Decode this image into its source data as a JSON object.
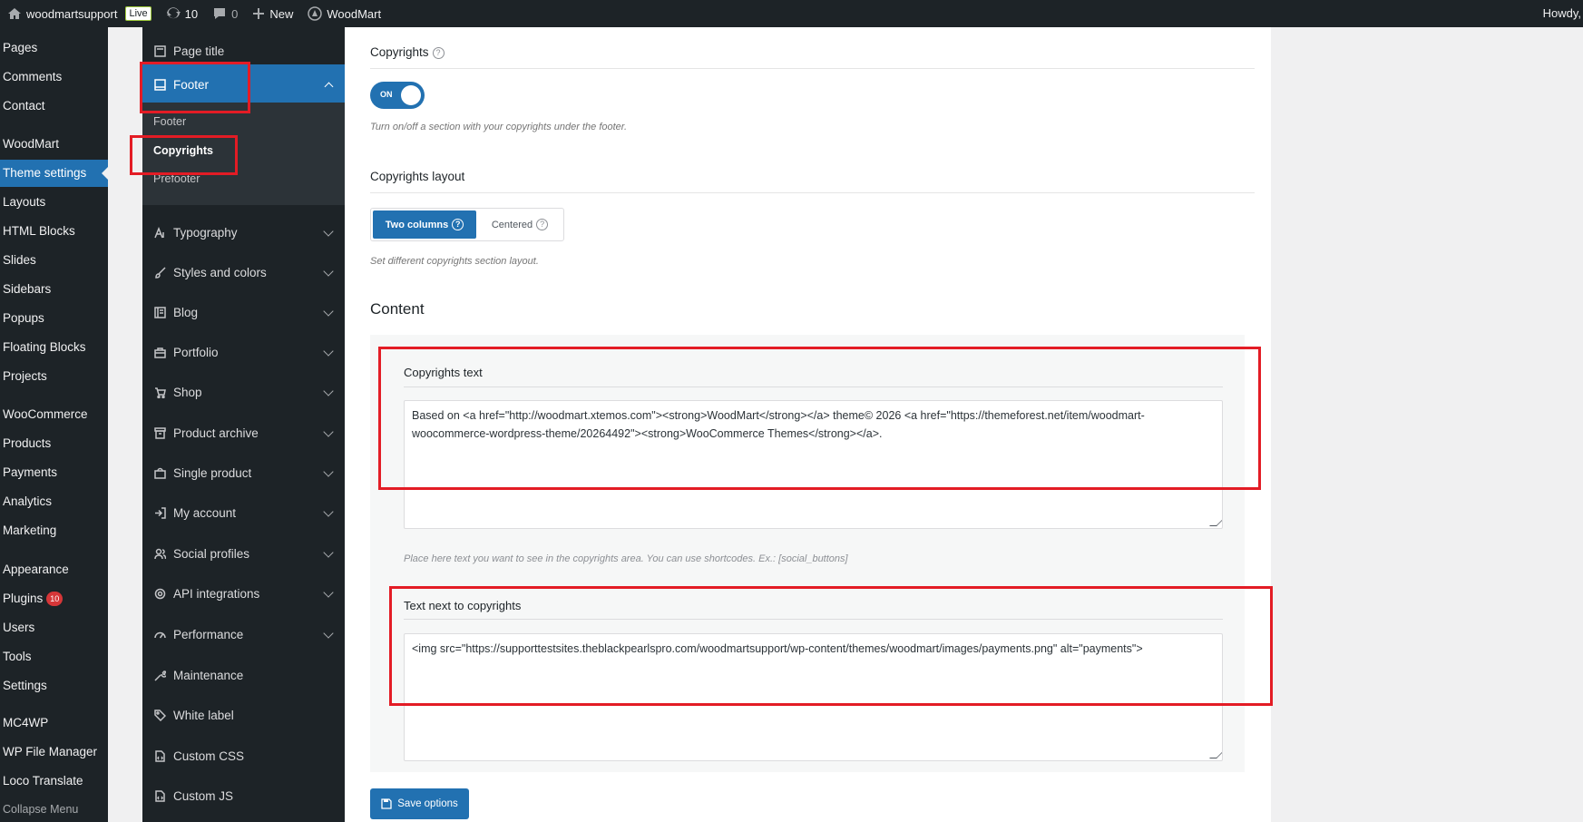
{
  "adminbar": {
    "site": "woodmartsupport",
    "live": "Live",
    "updates": "10",
    "comments": "0",
    "new": "New",
    "woodmart": "WoodMart",
    "howdy": "Howdy,"
  },
  "wpmenu": {
    "items": [
      "Pages",
      "Comments",
      "Contact",
      "WoodMart",
      "Theme settings",
      "Layouts",
      "HTML Blocks",
      "Slides",
      "Sidebars",
      "Popups",
      "Floating Blocks",
      "Projects",
      "WooCommerce",
      "Products",
      "Payments",
      "Analytics",
      "Marketing",
      "Appearance",
      "Plugins",
      "Users",
      "Tools",
      "Settings",
      "MC4WP",
      "WP File Manager",
      "Loco Translate",
      "Collapse Menu"
    ],
    "plugins_badge": "10"
  },
  "tnav": {
    "page_title": "Page title",
    "footer": "Footer",
    "sub": [
      "Footer",
      "Copyrights",
      "Prefooter"
    ],
    "sections": [
      "Typography",
      "Styles and colors",
      "Blog",
      "Portfolio",
      "Shop",
      "Product archive",
      "Single product",
      "My account",
      "Social profiles",
      "API integrations",
      "Performance",
      "Maintenance",
      "White label",
      "Custom CSS",
      "Custom JS"
    ]
  },
  "main": {
    "copyrights_title": "Copyrights",
    "toggle_label": "ON",
    "toggle_desc": "Turn on/off a section with your copyrights under the footer.",
    "layout_title": "Copyrights layout",
    "layout_options": [
      "Two columns",
      "Centered"
    ],
    "layout_desc": "Set different copyrights section layout.",
    "content_heading": "Content",
    "copy_text_title": "Copyrights text",
    "copy_text_value": "Based on <a href=\"http://woodmart.xtemos.com\"><strong>WoodMart</strong></a> theme© 2026 <a href=\"https://themeforest.net/item/woodmart-woocommerce-wordpress-theme/20264492\"><strong>WooCommerce Themes</strong></a>.",
    "copy_text_desc": "Place here text you want to see in the copyrights area. You can use shortcodes. Ex.: [social_buttons]",
    "next_text_title": "Text next to copyrights",
    "next_text_value": "<img src=\"https://supporttestsites.theblackpearlspro.com/woodmartsupport/wp-content/themes/woodmart/images/payments.png\" alt=\"payments\">",
    "save_label": "Save options"
  },
  "colors": {
    "accent": "#2271b1",
    "highlight": "#e31c25",
    "sidebar": "#1d2327"
  }
}
